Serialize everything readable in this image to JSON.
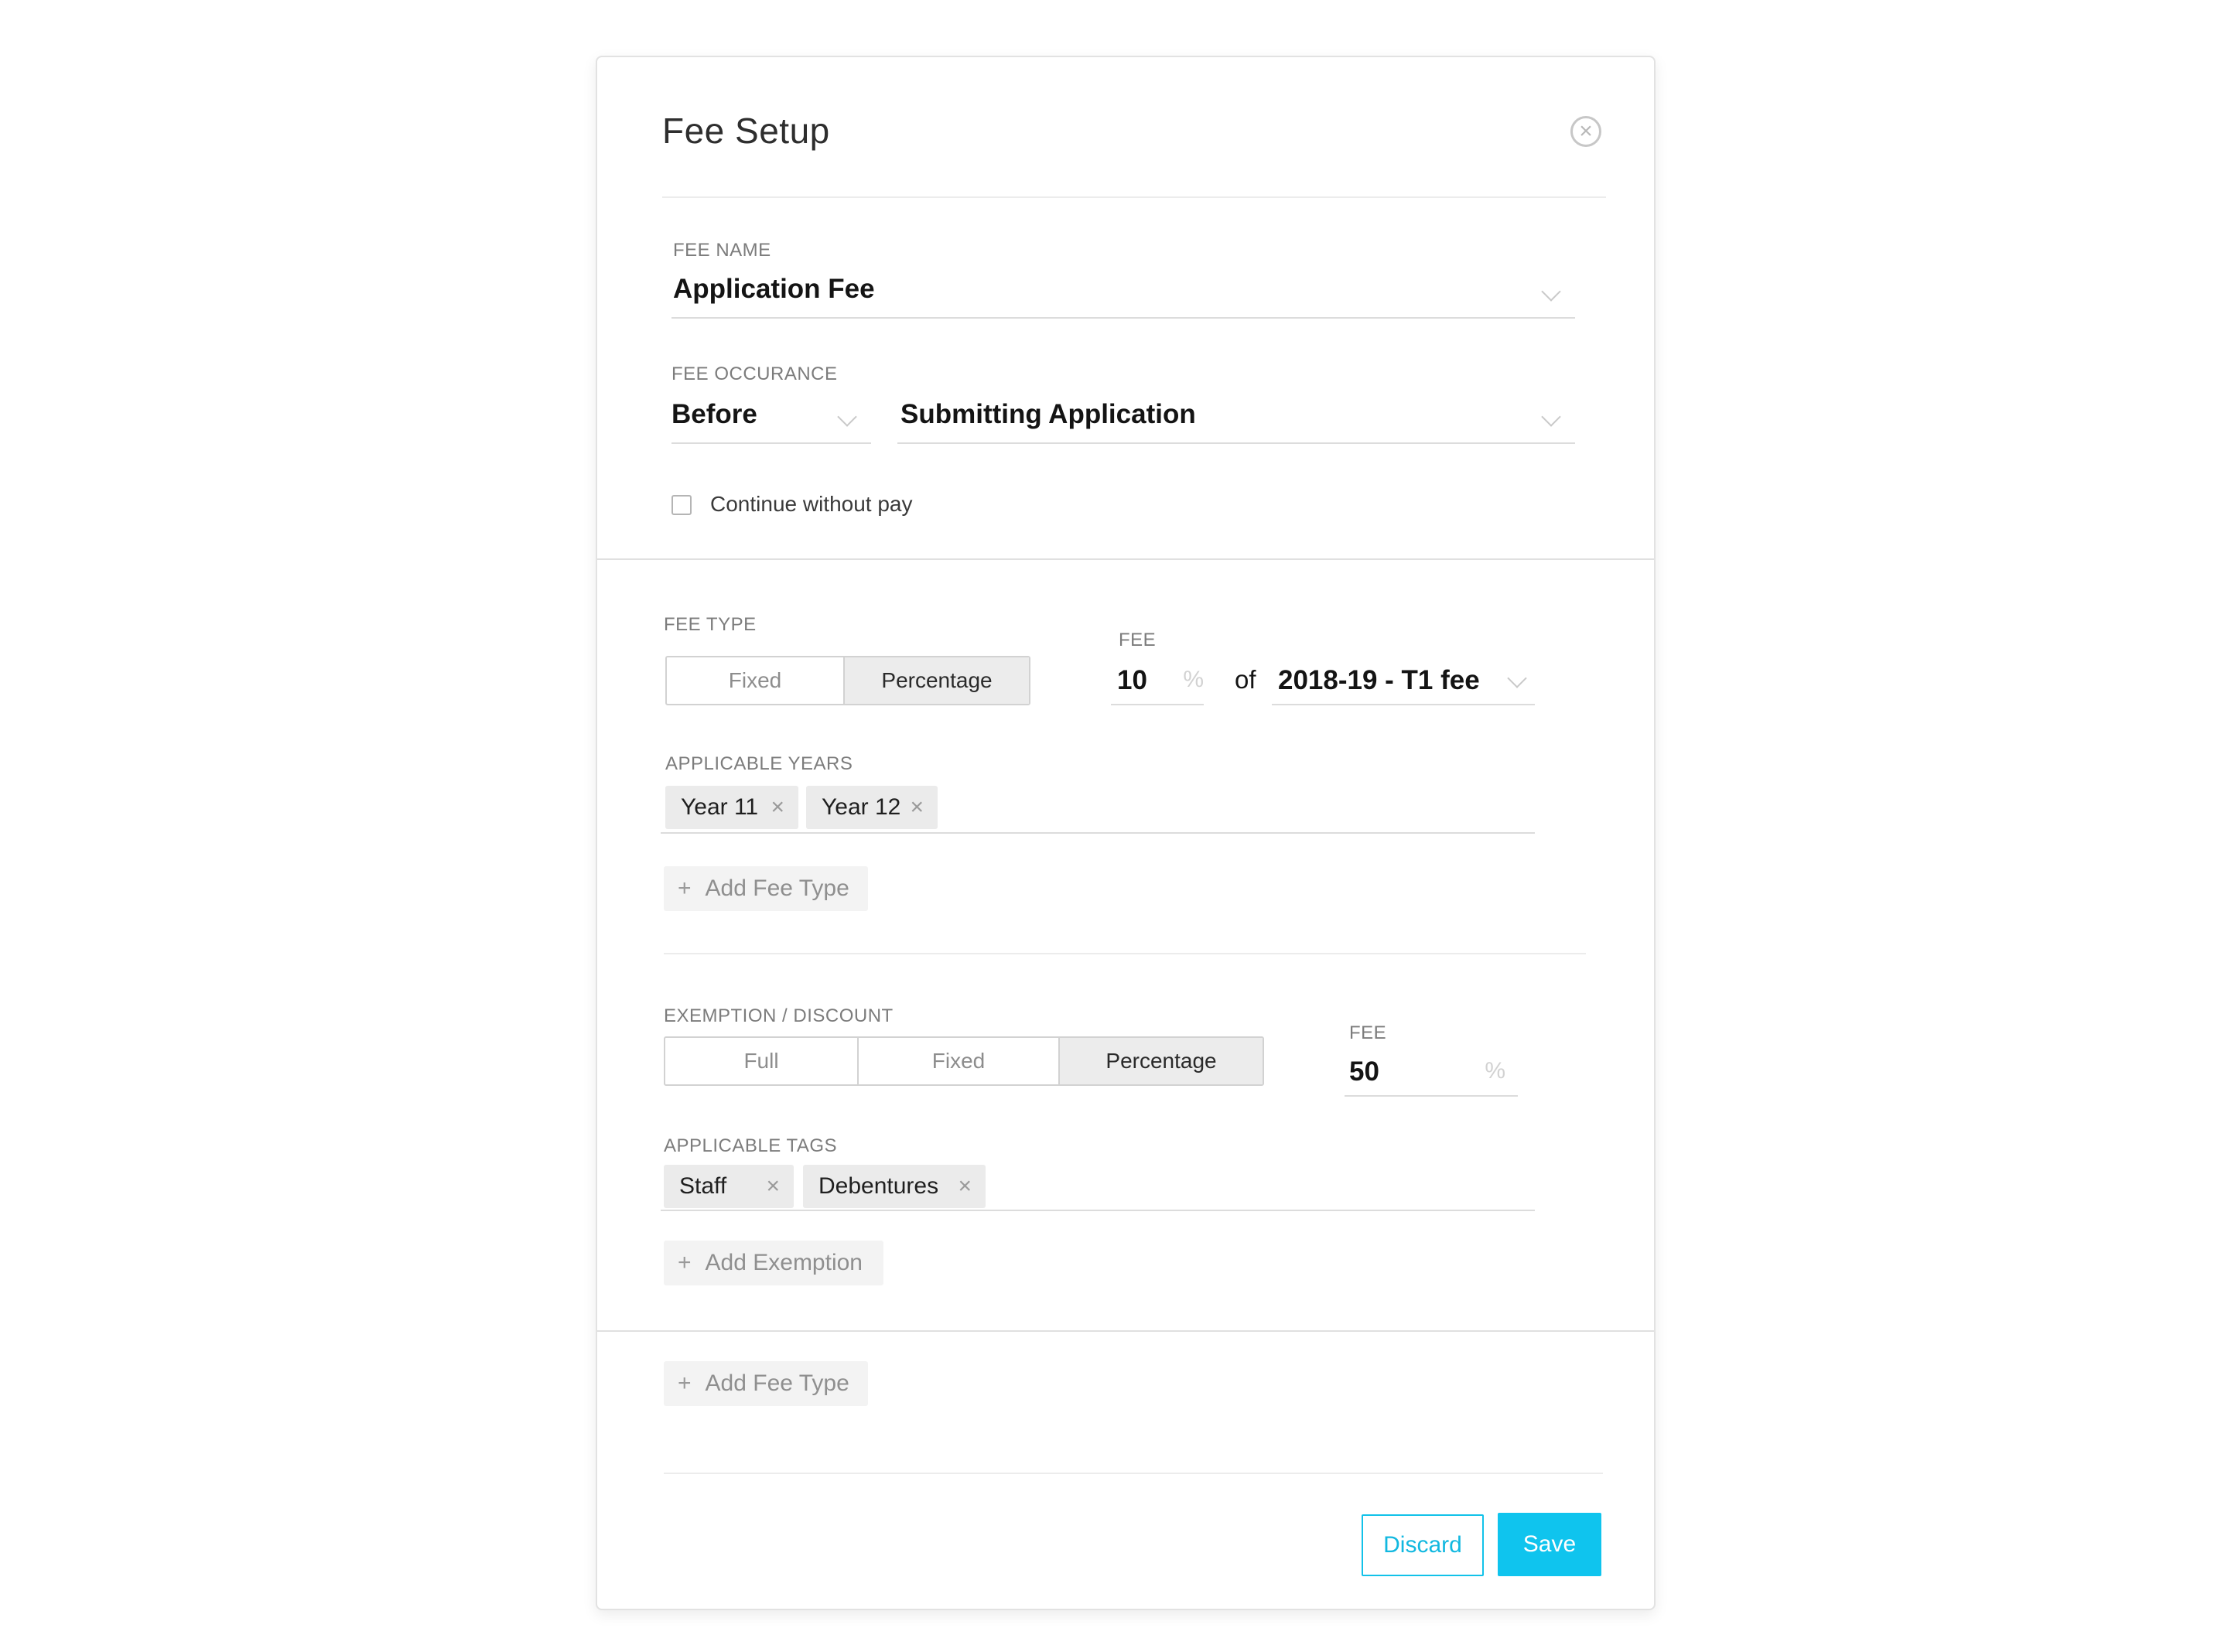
{
  "modal": {
    "title": "Fee Setup"
  },
  "fee_name": {
    "label": "FEE NAME",
    "value": "Application Fee"
  },
  "fee_occurance": {
    "label": "FEE OCCURANCE",
    "timing": "Before",
    "event": "Submitting Application"
  },
  "continue_without_pay": {
    "label": "Continue without pay",
    "checked": false
  },
  "fee_type": {
    "label": "FEE TYPE",
    "options": [
      "Fixed",
      "Percentage"
    ],
    "selected": "Percentage",
    "fee_label": "FEE",
    "fee_value": "10",
    "fee_unit": "%",
    "of_label": "of",
    "base_fee": "2018-19 - T1 fee"
  },
  "applicable_years": {
    "label": "APPLICABLE YEARS",
    "tags": [
      "Year 11",
      "Year 12"
    ],
    "remove_glyph": "×"
  },
  "add_fee_type_inner": {
    "plus": "+",
    "label": "Add Fee Type"
  },
  "exemption": {
    "label": "EXEMPTION / DISCOUNT",
    "options": [
      "Full",
      "Fixed",
      "Percentage"
    ],
    "selected": "Percentage",
    "fee_label": "FEE",
    "fee_value": "50",
    "fee_unit": "%"
  },
  "applicable_tags": {
    "label": "APPLICABLE TAGS",
    "tags": [
      "Staff",
      "Debentures"
    ],
    "remove_glyph": "×"
  },
  "add_exemption": {
    "plus": "+",
    "label": "Add Exemption"
  },
  "add_fee_type_outer": {
    "plus": "+",
    "label": "Add Fee Type"
  },
  "footer": {
    "discard_label": "Discard",
    "save_label": "Save"
  },
  "colors": {
    "accent": "#0fc4ee",
    "tag_bg": "#ebebeb",
    "segment_active_bg": "#ececec"
  },
  "icons": {
    "close": "close-circle-icon",
    "chevron": "chevron-down-icon",
    "remove": "remove-x-icon",
    "plus": "plus-icon"
  }
}
